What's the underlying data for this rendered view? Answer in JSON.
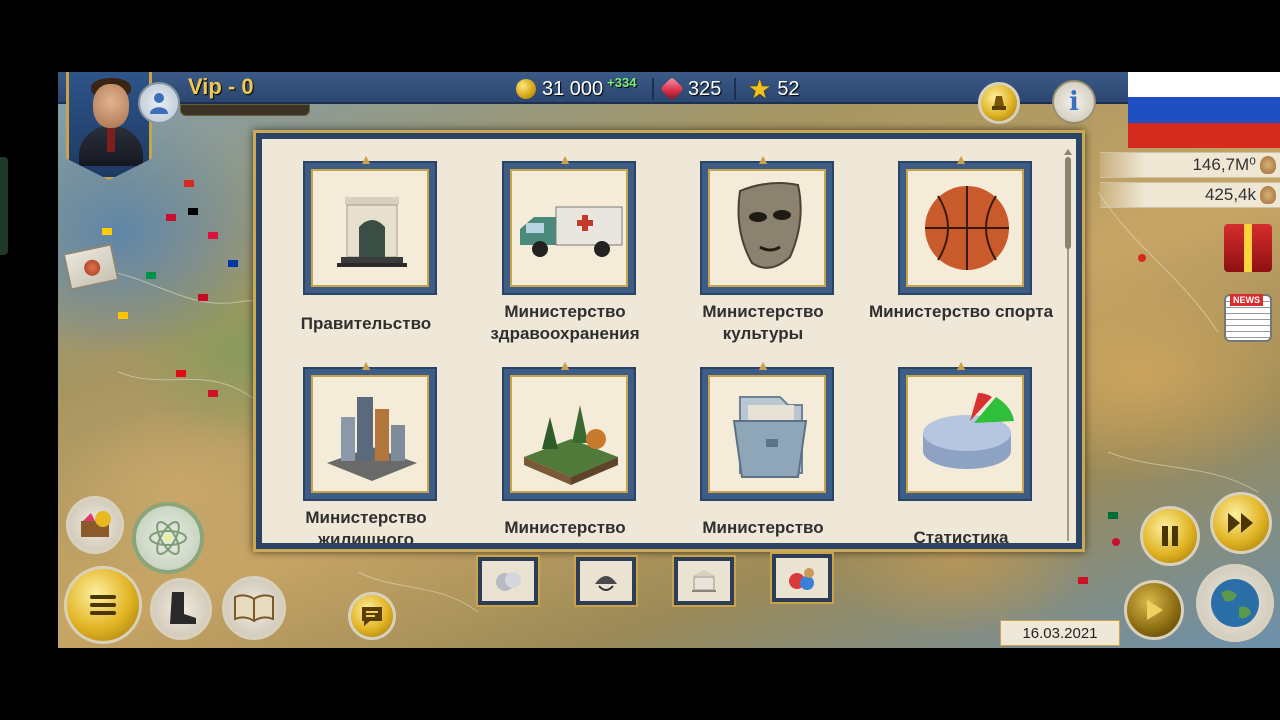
{
  "header": {
    "vip_label": "Vip - 0",
    "money": "31 000",
    "money_bonus": "+334",
    "gems": "325",
    "stars": "52"
  },
  "stats": {
    "population": "146,7M⁰",
    "army": "425,4k"
  },
  "icons": {
    "profile": "person-icon",
    "advisor": "judge-icon",
    "info": "info-icon",
    "gift": "gift-icon",
    "news": "newspaper-icon",
    "mail": "mail-icon",
    "shop": "treasure-icon",
    "science": "atom-icon",
    "menu": "menu-icon",
    "army": "boot-icon",
    "book": "book-icon",
    "chat": "chat-icon",
    "pause": "pause-icon",
    "fast_forward": "fast-forward-icon",
    "play": "play-icon",
    "globe": "globe-icon"
  },
  "info_glyph": "i",
  "news_tag": "NEWS",
  "flag_colors": [
    "#ffffff",
    "#1f4fc2",
    "#d52b1e"
  ],
  "ministries": [
    {
      "label": "Правительство",
      "icon": "government-building-icon"
    },
    {
      "label": "Министерство здравоохранения",
      "icon": "ambulance-icon"
    },
    {
      "label": "Министерство культуры",
      "icon": "mask-icon"
    },
    {
      "label": "Министерство спорта",
      "icon": "basketball-icon"
    },
    {
      "label": "Министерство жилищного",
      "icon": "city-icon"
    },
    {
      "label": "Министерство",
      "icon": "forest-icon"
    },
    {
      "label": "Министерство",
      "icon": "folder-icon"
    },
    {
      "label": "Статистика",
      "icon": "pie-chart-icon"
    }
  ],
  "bottom_tabs": [
    {
      "name": "tab-coins",
      "icon": "coins-icon"
    },
    {
      "name": "tab-military",
      "icon": "helmet-icon"
    },
    {
      "name": "tab-government",
      "icon": "building-icon"
    },
    {
      "name": "tab-society",
      "icon": "people-icon"
    }
  ],
  "date": "16.03.2021"
}
